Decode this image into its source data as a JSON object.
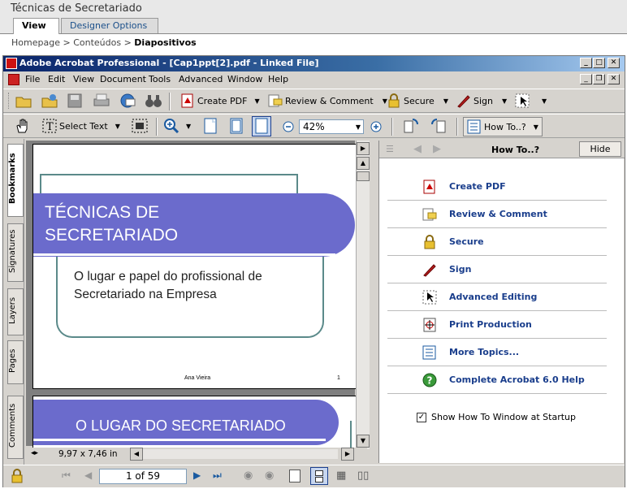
{
  "site": {
    "title": "Técnicas de Secretariado",
    "tabs": [
      "View",
      "Designer Options"
    ],
    "breadcrumb": {
      "home": "Homepage",
      "sep1": " > ",
      "contents": "Conteúdos",
      "sep2": " > ",
      "current": "Diapositivos"
    }
  },
  "acrobat": {
    "title": "Adobe Acrobat Professional - [Cap1ppt[2].pdf - Linked File]",
    "menu": [
      "File",
      "Edit",
      "View",
      "Document",
      "Tools",
      "Advanced",
      "Window",
      "Help"
    ],
    "toolbar1": {
      "create_pdf": "Create PDF",
      "review": "Review & Comment",
      "secure": "Secure",
      "sign": "Sign"
    },
    "toolbar2": {
      "select_text": "Select Text",
      "zoom": "42%",
      "howto": "How To..?"
    },
    "nav_tabs": [
      "Bookmarks",
      "Signatures",
      "Layers",
      "Pages",
      "Comments"
    ],
    "slide1": {
      "title_line1": "TÉCNICAS DE",
      "title_line2": "SECRETARIADO",
      "subtitle": "O lugar e papel do profissional de Secretariado na Empresa",
      "author": "Ana Vieira",
      "page": "1"
    },
    "slide2": {
      "title": "O LUGAR DO SECRETARIADO"
    },
    "page_size": "9,97 x 7,46 in",
    "page_counter": "1 of 59",
    "howto": {
      "title": "How To..?",
      "hide": "Hide",
      "items": [
        "Create PDF",
        "Review & Comment",
        "Secure",
        "Sign",
        "Advanced Editing",
        "Print Production",
        "More Topics...",
        "Complete Acrobat 6.0 Help"
      ],
      "startup_label": "Show How To Window at Startup",
      "startup_checked": true
    },
    "colors": {
      "accent": "#6b6bcc",
      "teal": "#5b8a8a",
      "link": "#1a3e8c"
    }
  }
}
